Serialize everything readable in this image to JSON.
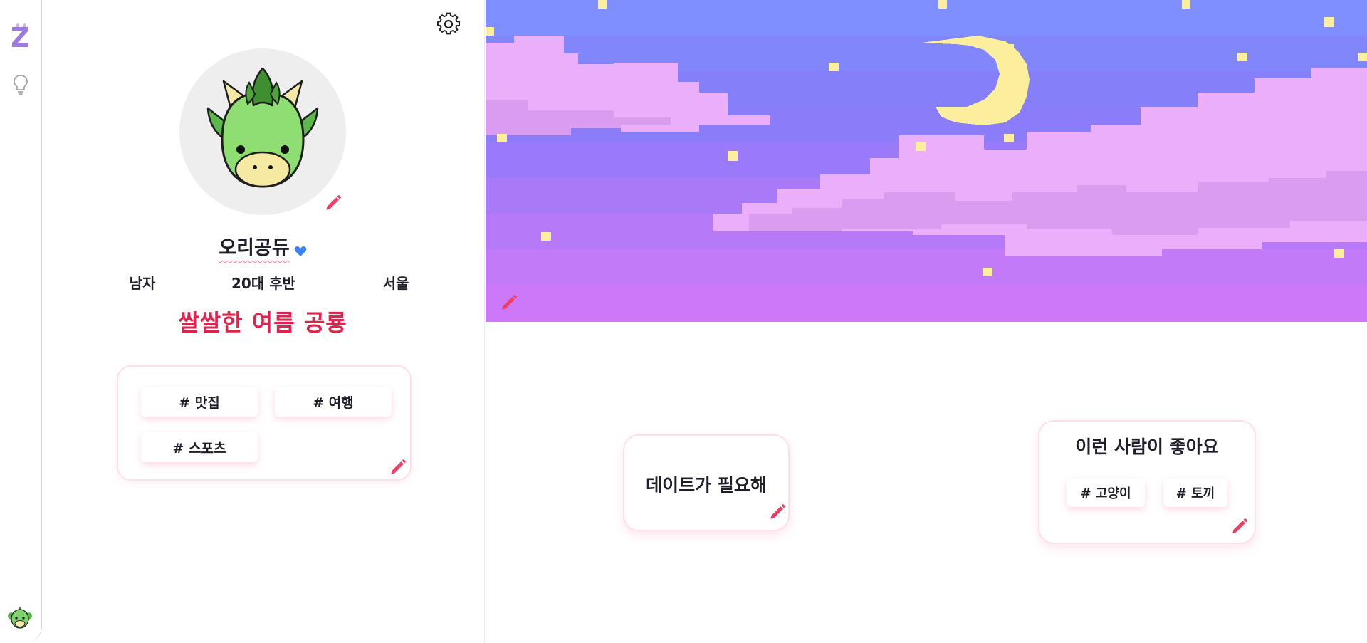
{
  "sidebar": {
    "logo_icon": "dragon-logo-icon",
    "hint_icon": "lightbulb-icon",
    "avatar_icon": "dragon-avatar-icon"
  },
  "profile": {
    "nickname": "오리공듀",
    "verified_icon": "heart-icon",
    "gender": "남자",
    "age": "20대 후반",
    "location": "서울",
    "status_message": "쌀쌀한 여름 공룡",
    "interests": [
      "# 맛집",
      "# 여행",
      "# 스포츠"
    ]
  },
  "cards": {
    "purpose": {
      "title": "데이트가 필요해"
    },
    "ideal": {
      "title": "이런 사람이 좋아요",
      "tags": [
        "# 고양이",
        "# 토끼"
      ]
    }
  },
  "colors": {
    "accent": "#e0234c",
    "pencil": "#ef3d63",
    "heart": "#3b82f6",
    "avatar_bg": "#eeeeef"
  }
}
